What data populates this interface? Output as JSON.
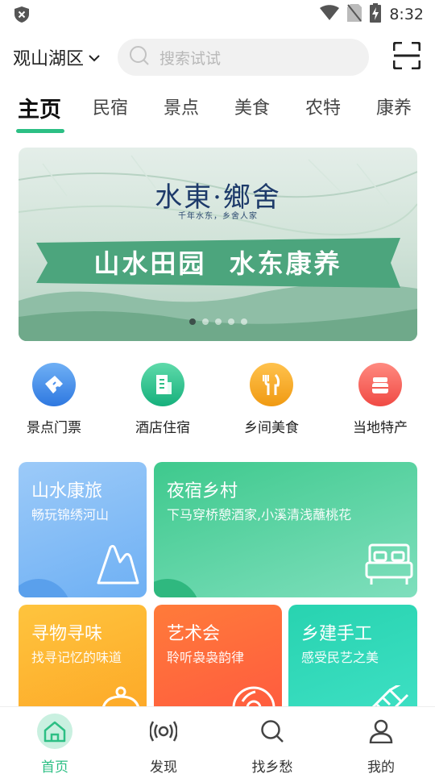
{
  "status_bar": {
    "time": "8:32",
    "icons": [
      "shield-icon",
      "wifi-icon",
      "no-sim-icon",
      "battery-charging-icon"
    ]
  },
  "header": {
    "location": "观山湖区",
    "search_placeholder": "搜索试试",
    "scan_icon": "scan-icon"
  },
  "tabs": [
    {
      "label": "主页",
      "active": true
    },
    {
      "label": "民宿",
      "active": false
    },
    {
      "label": "景点",
      "active": false
    },
    {
      "label": "美食",
      "active": false
    },
    {
      "label": "农特",
      "active": false
    },
    {
      "label": "康养",
      "active": false
    }
  ],
  "banner": {
    "logo": "水東·鄉舍",
    "logo_sub": "千年水东，乡舍人家",
    "slogan": "山水田园  水东康养",
    "slide_count": 5,
    "active_slide": 0
  },
  "quick_nav": [
    {
      "label": "景点门票",
      "icon": "ticket-icon",
      "color": "#3b86e8"
    },
    {
      "label": "酒店住宿",
      "icon": "building-icon",
      "color": "#22c08c"
    },
    {
      "label": "乡间美食",
      "icon": "fork-knife-icon",
      "color": "#f5a524"
    },
    {
      "label": "当地特产",
      "icon": "jar-icon",
      "color": "#f25b52"
    }
  ],
  "cards": {
    "shanshui": {
      "title": "山水康旅",
      "subtitle": "畅玩锦绣河山",
      "icon": "mountain-icon"
    },
    "yesu": {
      "title": "夜宿乡村",
      "subtitle": "下马穿桥憩酒家,小溪清浅蘸桃花",
      "icon": "bed-icon"
    },
    "xunwu": {
      "title": "寻物寻味",
      "subtitle": "找寻记忆的味道",
      "icon": "dish-icon"
    },
    "yishu": {
      "title": "艺术会",
      "subtitle": "聆听袅袅韵律",
      "icon": "music-disc-icon"
    },
    "xiangjian": {
      "title": "乡建手工",
      "subtitle": "感受民艺之美",
      "icon": "craft-tool-icon"
    }
  },
  "bottom_nav": [
    {
      "label": "首页",
      "icon": "home-icon",
      "active": true
    },
    {
      "label": "发现",
      "icon": "broadcast-icon",
      "active": false
    },
    {
      "label": "找乡愁",
      "icon": "search-icon",
      "active": false
    },
    {
      "label": "我的",
      "icon": "user-icon",
      "active": false
    }
  ],
  "colors": {
    "accent": "#2cbf84",
    "card_blue": "#8cc2f7",
    "card_green": "#4fcf9a",
    "card_orange": "#fdb72c",
    "card_red": "#ff6a3d",
    "card_teal": "#2cd6b4"
  }
}
